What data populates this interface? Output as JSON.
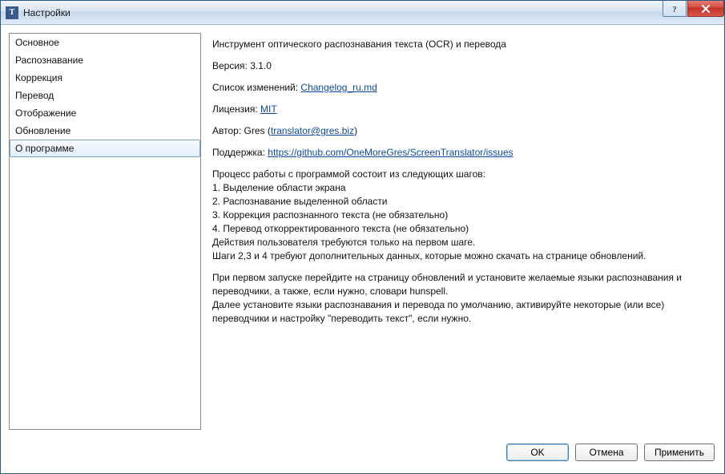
{
  "window": {
    "title": "Настройки"
  },
  "sidebar": {
    "items": [
      {
        "label": "Основное",
        "selected": false
      },
      {
        "label": "Распознавание",
        "selected": false
      },
      {
        "label": "Коррекция",
        "selected": false
      },
      {
        "label": "Перевод",
        "selected": false
      },
      {
        "label": "Отображение",
        "selected": false
      },
      {
        "label": "Обновление",
        "selected": false
      },
      {
        "label": "О программе",
        "selected": true
      }
    ]
  },
  "about": {
    "heading": "Инструмент оптического распознавания текста (OCR) и перевода",
    "version_label": "Версия:",
    "version_value": "3.1.0",
    "changelog_label": "Список изменений:",
    "changelog_link": "Changelog_ru.md",
    "license_label": "Лицензия:",
    "license_link": "MIT",
    "author_label": "Автор:",
    "author_name": "Gres",
    "author_email": "translator@gres.biz",
    "support_label": "Поддержка:",
    "support_link": "https://github.com/OneMoreGres/ScreenTranslator/issues",
    "desc": {
      "l0": "Процесс работы с программой состоит из следующих шагов:",
      "l1": "1. Выделение области экрана",
      "l2": "2. Распознавание выделенной области",
      "l3": "3. Коррекция распознанного текста (не обязательно)",
      "l4": "4. Перевод откорректированного текста (не обязательно)",
      "l5": "Действия пользователя требуются только на первом шаге.",
      "l6": "Шаги 2,3 и 4 требуют дополнительных данных, которые можно скачать на странице обновлений.",
      "l7": "При первом запуске перейдите на страницу обновлений и установите желаемые языки распознавания и переводчики, а также, если нужно, словари hunspell.",
      "l8": "Далее установите языки распознавания и перевода по умолчанию, активируйте некоторые (или все) переводчики и настройку \"переводить текст\", если нужно."
    }
  },
  "footer": {
    "ok": "OK",
    "cancel": "Отмена",
    "apply": "Применить"
  }
}
